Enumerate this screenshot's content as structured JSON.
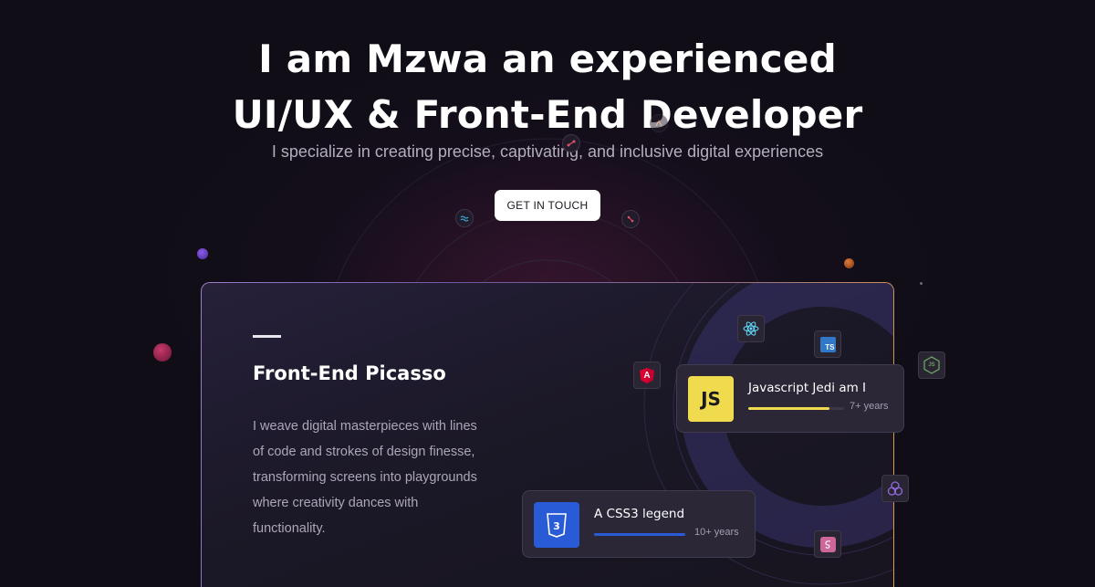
{
  "hero": {
    "title_line1": "I am Mzwa an experienced",
    "title_line2": "UI/UX & Front-End Developer",
    "subtitle": "I specialize in creating precise, captivating, and inclusive digital experiences",
    "cta_label": "GET IN TOUCH"
  },
  "card": {
    "title": "Front-End Picasso",
    "description": "I weave digital masterpieces with lines of code and strokes of design finesse, transforming screens into playgrounds where creativity dances with functionality."
  },
  "skills": [
    {
      "name": "Javascript Jedi am I",
      "logo_text": "JS",
      "years": "7+ years",
      "progress": 0.85,
      "color": "#f0db4f"
    },
    {
      "name": "A CSS3 legend",
      "logo_text": "CSS3",
      "years": "10+ years",
      "progress": 1.0,
      "color": "#2a5bd7"
    }
  ],
  "tech_icons": [
    "react-icon",
    "typescript-icon",
    "angular-icon",
    "nodejs-icon",
    "redux-icon",
    "sass-icon"
  ],
  "tile_labels": {
    "typescript": "TS",
    "angular": "A",
    "nodejs": "JS"
  },
  "colors": {
    "background": "#100d16",
    "accent_orange": "#e0a04a",
    "accent_purple": "#6a3fd0"
  }
}
